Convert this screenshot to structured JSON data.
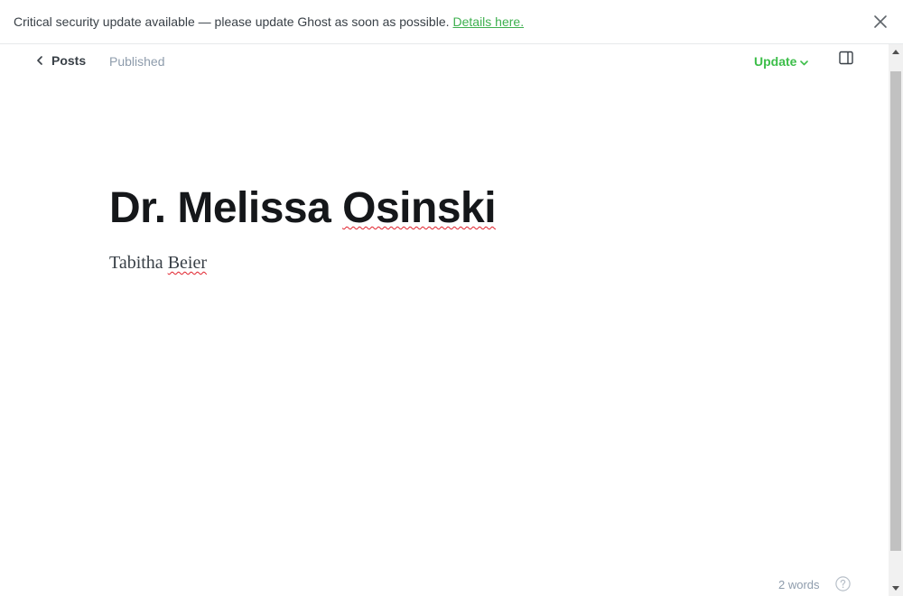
{
  "banner": {
    "message": "Critical security update available — please update Ghost as soon as possible.",
    "link_text": "Details here.",
    "close_icon": "close-icon"
  },
  "topbar": {
    "back_label": "Posts",
    "back_icon": "chevron-left-icon",
    "status": "Published",
    "update_label": "Update",
    "update_icon": "chevron-down-icon",
    "settings_icon": "sidebar-toggle-icon"
  },
  "post": {
    "title_part1": "Dr. Melissa ",
    "title_part2": "Osinski",
    "body_part1": "Tabitha ",
    "body_part2": "Beier"
  },
  "footer": {
    "word_count": "2 words",
    "help_icon": "help-icon"
  },
  "colors": {
    "accent_green": "#3dbe4a",
    "spellcheck_red": "#e0202a",
    "muted_text": "#8e9cac"
  }
}
